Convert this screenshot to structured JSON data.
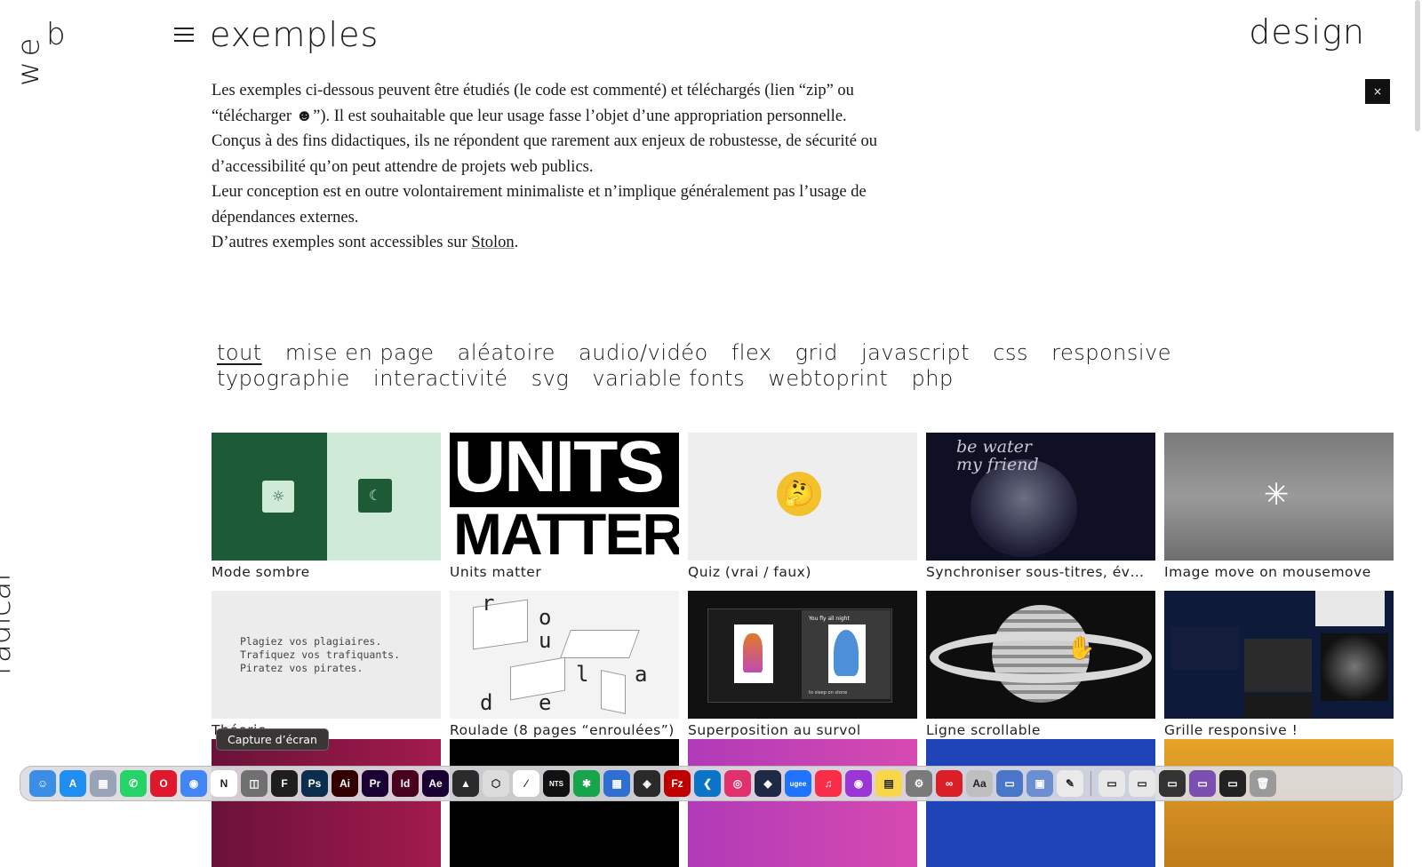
{
  "logo": {
    "top": "web",
    "bottom": "radical"
  },
  "header": {
    "title": "exemples",
    "right": "design",
    "close_label": "×"
  },
  "intro": {
    "p1": "Les exemples ci-dessous peuvent être étudiés (le code est commenté) et téléchargés (lien “zip” ou “télécharger ☻”). Il est souhaitable que leur usage fasse l’objet d’une appropriation personnelle.",
    "p2": "Conçus à des fins didactiques, ils ne répondent que rarement aux enjeux de robustesse, de sécurité ou d’accessibilité qu’on peut attendre de projets web publics.",
    "p3": "Leur conception est en outre volontairement minimaliste et n’implique généralement pas l’usage de dépendances externes.",
    "p4_before": "D’autres exemples sont accessibles sur ",
    "p4_link": "Stolon",
    "p4_after": "."
  },
  "filters": [
    "tout",
    "mise en page",
    "aléatoire",
    "audio/vidéo",
    "flex",
    "grid",
    "javascript",
    "css",
    "responsive",
    "typographie",
    "interactivité",
    "svg",
    "variable fonts",
    "webtoprint",
    "php"
  ],
  "cards": [
    {
      "caption": "Mode sombre"
    },
    {
      "caption": "Units matter",
      "thumb_line1": "UNITS",
      "thumb_line2": "MATTER"
    },
    {
      "caption": "Quiz (vrai / faux)",
      "thumb_emoji": "🤔"
    },
    {
      "caption": "Synchroniser sous-titres, év…",
      "thumb_text1": "be water",
      "thumb_text2": "my friend"
    },
    {
      "caption": "Image move on mousemove"
    },
    {
      "caption": "Théorie",
      "thumb_text": "Plagiez vos plagiaires.\nTrafiquez vos trafiquants.\nPiratez vos pirates."
    },
    {
      "caption": "Roulade (8 pages “enroulées”)",
      "thumb_letters": [
        "r",
        "o",
        "u",
        "l",
        "a",
        "d",
        "e"
      ]
    },
    {
      "caption": "Superposition au survol",
      "thumb_header": "You fly all night",
      "thumb_footer": "to sleep on stone"
    },
    {
      "caption": "Ligne scrollable"
    },
    {
      "caption": "Grille responsive !"
    }
  ],
  "tooltip": "Capture d’écran",
  "dock": [
    {
      "name": "finder-icon",
      "color": "#3a8ee6",
      "glyph": "☺"
    },
    {
      "name": "app-store-icon",
      "color": "#1f8ef1",
      "glyph": "A"
    },
    {
      "name": "launchpad-icon",
      "color": "#9aa3b5",
      "glyph": "▦"
    },
    {
      "name": "whatsapp-icon",
      "color": "#25d366",
      "glyph": "✆"
    },
    {
      "name": "opera-icon",
      "color": "#e0182d",
      "glyph": "O"
    },
    {
      "name": "chrome-icon",
      "color": "#4285f4",
      "glyph": "◉"
    },
    {
      "name": "notion-icon",
      "color": "#ffffff",
      "glyph": "N"
    },
    {
      "name": "screenshot-icon",
      "color": "#707070",
      "glyph": "◫"
    },
    {
      "name": "figma-icon",
      "color": "#1e1e1e",
      "glyph": "F"
    },
    {
      "name": "photoshop-icon",
      "color": "#0b2e4f",
      "glyph": "Ps"
    },
    {
      "name": "illustrator-icon",
      "color": "#330000",
      "glyph": "Ai"
    },
    {
      "name": "premiere-icon",
      "color": "#1a0033",
      "glyph": "Pr"
    },
    {
      "name": "indesign-icon",
      "color": "#49021f",
      "glyph": "Id"
    },
    {
      "name": "after-effects-icon",
      "color": "#1a0033",
      "glyph": "Ae"
    },
    {
      "name": "affinity-icon",
      "color": "#2b2b2b",
      "glyph": "▲"
    },
    {
      "name": "cube-icon",
      "color": "#dcdcdc",
      "glyph": "⬡"
    },
    {
      "name": "inkscape-icon",
      "color": "#ffffff",
      "glyph": "∕"
    },
    {
      "name": "fonts-icon",
      "color": "#111111",
      "glyph": "NTS"
    },
    {
      "name": "monitor-icon",
      "color": "#17a44a",
      "glyph": "✱"
    },
    {
      "name": "calculator-icon",
      "color": "#2e6fd1",
      "glyph": "▦"
    },
    {
      "name": "unity-icon",
      "color": "#2a2a2a",
      "glyph": "◈"
    },
    {
      "name": "filezilla-icon",
      "color": "#bf0000",
      "glyph": "Fz"
    },
    {
      "name": "vscode-icon",
      "color": "#0a74c9",
      "glyph": "❮"
    },
    {
      "name": "instagram-icon",
      "color": "#e1306c",
      "glyph": "◎"
    },
    {
      "name": "codekit-icon",
      "color": "#1e2a44",
      "glyph": "◆"
    },
    {
      "name": "ugee-icon",
      "color": "#1e74ff",
      "glyph": "ugee"
    },
    {
      "name": "music-icon",
      "color": "#fa2d48",
      "glyph": "♫"
    },
    {
      "name": "podcasts-icon",
      "color": "#9b36d6",
      "glyph": "◉"
    },
    {
      "name": "notes-icon",
      "color": "#f7d64a",
      "glyph": "▤"
    },
    {
      "name": "settings-icon",
      "color": "#7a7a7a",
      "glyph": "⚙"
    },
    {
      "name": "creative-cloud-icon",
      "color": "#da1f26",
      "glyph": "∞"
    },
    {
      "name": "font-book-icon",
      "color": "#bfbfbf",
      "glyph": "Aa"
    },
    {
      "name": "preview-icon",
      "color": "#4a76c8",
      "glyph": "▭"
    },
    {
      "name": "display-icon",
      "color": "#6c8fd1",
      "glyph": "▣"
    },
    {
      "name": "textedit-icon",
      "color": "#eaeaea",
      "glyph": "✎"
    },
    {
      "name": "document-icon-1",
      "color": "#e8e8e8",
      "glyph": "▭"
    },
    {
      "name": "document-icon-2",
      "color": "#e8e8e8",
      "glyph": "▭"
    },
    {
      "name": "document-icon-3",
      "color": "#333333",
      "glyph": "▭"
    },
    {
      "name": "document-icon-4",
      "color": "#7a4fb0",
      "glyph": "▭"
    },
    {
      "name": "document-icon-5",
      "color": "#222222",
      "glyph": "▭"
    },
    {
      "name": "trash-icon",
      "color": "#9a9a9a",
      "glyph": "🗑"
    }
  ]
}
